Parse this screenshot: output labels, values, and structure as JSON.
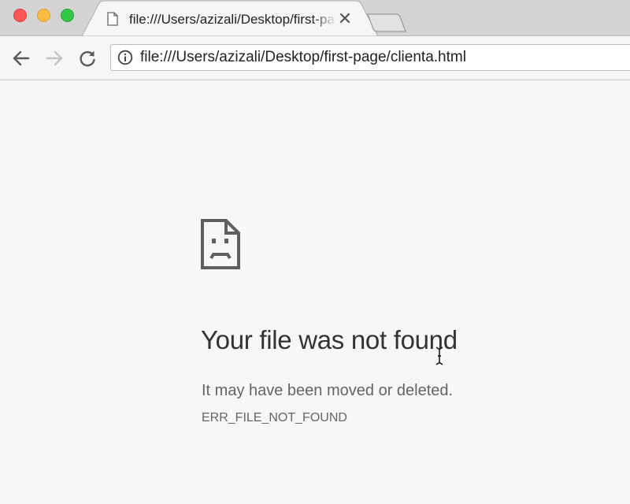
{
  "window": {
    "controls": [
      "close",
      "minimize",
      "zoom"
    ]
  },
  "tab": {
    "title": "file:///Users/azizali/Desktop/first-page/clienta.html",
    "icon": "document-icon",
    "close_label": "✕"
  },
  "toolbar": {
    "back_icon": "arrow-left-icon",
    "forward_icon": "arrow-right-icon",
    "reload_icon": "reload-icon"
  },
  "omnibox": {
    "icon": "info-icon",
    "url": "file:///Users/azizali/Desktop/first-page/clienta.html"
  },
  "error": {
    "icon": "sad-file-icon",
    "headline": "Your file was not found",
    "description": "It may have been moved or deleted.",
    "code": "ERR_FILE_NOT_FOUND"
  }
}
